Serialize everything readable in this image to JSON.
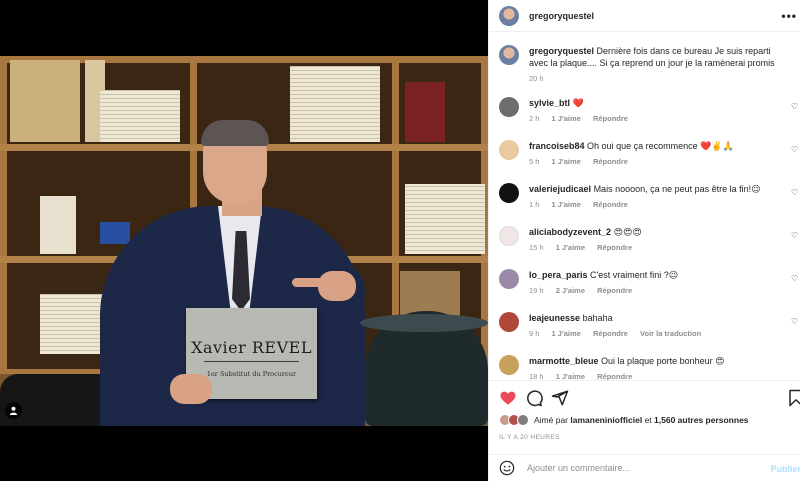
{
  "post": {
    "plaque_name": "Xavier REVEL",
    "plaque_title": "1er Substitut du Procureur"
  },
  "header": {
    "username": "gregoryquestel",
    "more_icon": "more-horizontal-icon"
  },
  "caption": {
    "username": "gregoryquestel",
    "text": "Dernière fois dans ce bureau Je suis reparti avec la plaque.... Si ça reprend un jour je la ramènerai promis",
    "time": "20 h"
  },
  "comments": [
    {
      "username": "sylvie_btl",
      "text": "❤️",
      "time": "2 h",
      "likes": "1 J'aime",
      "reply": "Répondre",
      "extra": "",
      "avatar_color": "#6d6d6d"
    },
    {
      "username": "francoiseb84",
      "text": "Oh oui que ça recommence ❤️✌️🙏",
      "time": "5 h",
      "likes": "1 J'aime",
      "reply": "Répondre",
      "extra": "",
      "avatar_color": "#e8c9a0"
    },
    {
      "username": "valeriejudicael",
      "text": "Mais noooon, ça ne peut pas être la fin!😉",
      "time": "1 h",
      "likes": "1 J'aime",
      "reply": "Répondre",
      "extra": "",
      "avatar_color": "#111111"
    },
    {
      "username": "aliciabodyzevent_2",
      "text": "😍😍😍",
      "time": "15 h",
      "likes": "1 J'aime",
      "reply": "Répondre",
      "extra": "",
      "avatar_color": "#f0e6e6"
    },
    {
      "username": "lo_pera_paris",
      "text": "C'est vraiment fini ?😉",
      "time": "19 h",
      "likes": "2 J'aime",
      "reply": "Répondre",
      "extra": "",
      "avatar_color": "#9a8aa8"
    },
    {
      "username": "leajeunesse",
      "text": "bahaha",
      "time": "9 h",
      "likes": "1 J'aime",
      "reply": "Répondre",
      "extra": "Voir la traduction",
      "avatar_color": "#b0483a"
    },
    {
      "username": "marmotte_bleue",
      "text": "Oui la plaque porte bonheur 😍",
      "time": "18 h",
      "likes": "1 J'aime",
      "reply": "Répondre",
      "extra": "",
      "avatar_color": "#c7a15a"
    }
  ],
  "actions": {
    "like_icon": "heart-filled-icon",
    "comment_icon": "comment-icon",
    "share_icon": "share-icon",
    "save_icon": "bookmark-icon",
    "like_color": "#ed4956"
  },
  "likes": {
    "prefix": "Aimé par",
    "user": "lamaneniniofficiel",
    "and": "et",
    "others": "1,560 autres personnes"
  },
  "time_ago": "IL Y A 20 HEURES",
  "composer": {
    "placeholder": "Ajouter un commentaire...",
    "post_label": "Publier",
    "emoji_icon": "emoji-icon"
  }
}
